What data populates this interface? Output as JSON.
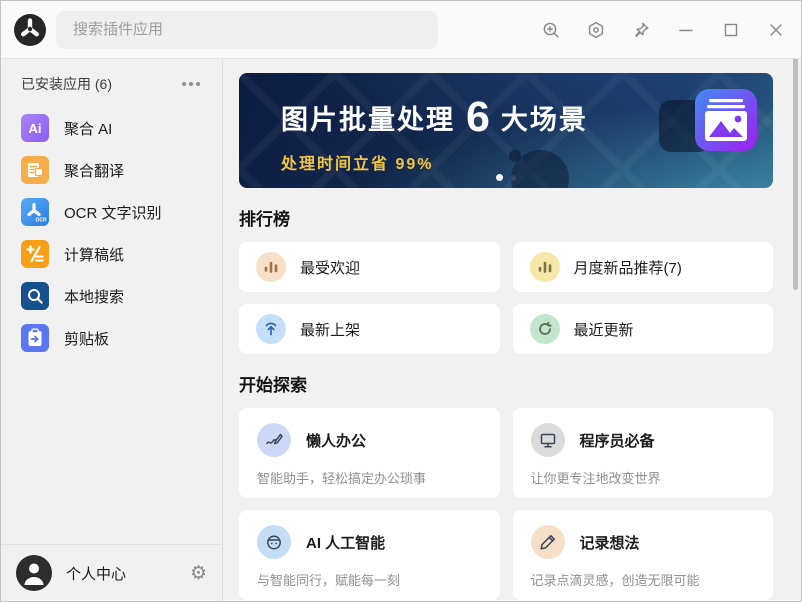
{
  "topbar": {
    "search_placeholder": "搜索插件应用",
    "control_icons": [
      "zoom-in",
      "settings-hexagon",
      "pin",
      "minimize",
      "maximize",
      "close"
    ]
  },
  "sidebar": {
    "header_label": "已安装应用 (6)",
    "items": [
      {
        "label": "聚合 AI",
        "icon": "ai-badge",
        "color": "#8a5cf0"
      },
      {
        "label": "聚合翻译",
        "icon": "translate-badge",
        "color": "#f6ae4a"
      },
      {
        "label": "OCR 文字识别",
        "icon": "ocr-badge",
        "color": "#2e7de2"
      },
      {
        "label": "计算稿纸",
        "icon": "calculator-badge",
        "color": "#f89f18"
      },
      {
        "label": "本地搜索",
        "icon": "local-search-badge",
        "color": "#17508f"
      },
      {
        "label": "剪贴板",
        "icon": "clipboard-badge",
        "color": "#5b76f0"
      }
    ],
    "footer_label": "个人中心"
  },
  "main": {
    "banner": {
      "title_prefix": "图片批量处理",
      "title_number": "6",
      "title_suffix": "大场景",
      "subtitle": "处理时间立省 99%",
      "accent_color": "#f2c53d",
      "background_color": "#13294f",
      "dots_total": 2,
      "active_dot": 1
    },
    "rank": {
      "title": "排行榜",
      "cards": [
        {
          "label": "最受欢迎",
          "icon": "bar-chart-icon",
          "icon_bg": "#f7e0c8",
          "icon_color": "#a3703f"
        },
        {
          "label": "月度新品推荐(7)",
          "icon": "bar-chart-icon",
          "icon_bg": "#f5e7a7",
          "icon_color": "#7c7247"
        },
        {
          "label": "最新上架",
          "icon": "upload-arrow-icon",
          "icon_bg": "#c5dff8",
          "icon_color": "#2b5f9e"
        },
        {
          "label": "最近更新",
          "icon": "refresh-icon",
          "icon_bg": "#c2e5cb",
          "icon_color": "#56705c"
        }
      ]
    },
    "explore": {
      "title": "开始探索",
      "cards": [
        {
          "label": "懒人办公",
          "desc": "智能助手，轻松搞定办公琐事",
          "icon": "chart-pen-icon",
          "icon_bg": "#cdd8f7"
        },
        {
          "label": "程序员必备",
          "desc": "让你更专注地改变世界",
          "icon": "monitor-icon",
          "icon_bg": "#dbdbdb"
        },
        {
          "label": "AI 人工智能",
          "desc": "与智能同行，赋能每一刻",
          "icon": "robot-icon",
          "icon_bg": "#c3ddf6"
        },
        {
          "label": "记录想法",
          "desc": "记录点滴灵感，创造无限可能",
          "icon": "pencil-icon",
          "icon_bg": "#f5dfc8"
        }
      ]
    }
  }
}
